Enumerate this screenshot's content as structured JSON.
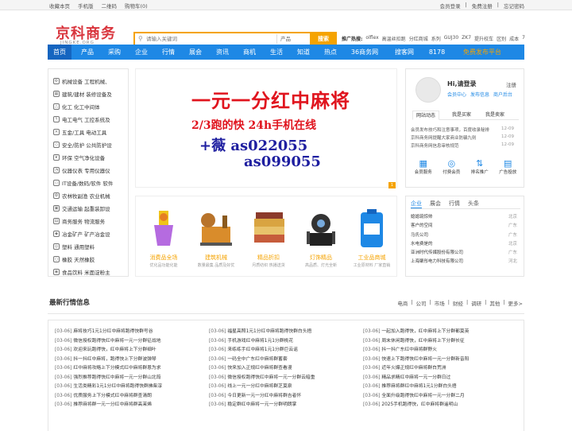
{
  "topbar": {
    "left": [
      "收藏本页",
      "手机版",
      "二维码",
      "购物车(0)"
    ],
    "right": [
      "会员登录",
      "免费注册",
      "忘记密码"
    ]
  },
  "header": {
    "logo": "京科商务",
    "logo_sub": "JINGKE.ORG",
    "search_placeholder": "请输入关键词",
    "search_select": "产品",
    "search_button": "搜索",
    "hot_label": "推广热搜:",
    "hot_terms": [
      "olflex",
      "高温丝扣跑",
      "分红商城",
      "系列",
      "GUJ30",
      "ZK7",
      "提升校车",
      "区别",
      "成本",
      "7"
    ]
  },
  "nav": [
    "首页",
    "产品",
    "采购",
    "企业",
    "行情",
    "展会",
    "资讯",
    "商机",
    "生活",
    "知道",
    "热点",
    "36商务网",
    "搜客网",
    "8178",
    "免费发布平台"
  ],
  "categories": [
    "机械设备 工程机械、",
    "建筑/建材 装修设备及",
    "化工 化工中间体",
    "电工电气 工控系统及",
    "五金/工具 电动工具",
    "安全/防护 公共防护设",
    "环保 空气净化设备",
    "仪器仪表 专用仪器仪",
    "IT设备/数码/软件 软件",
    "农林牧副渔 农业机械",
    "交通运输 起重装卸设",
    "商务服务 物流服务",
    "冶金矿产 矿产冶金设",
    "塑料 通用塑料",
    "橡胶 天然橡胶",
    "食品饮料 米面淀粉主"
  ],
  "banner": {
    "line1": "一元一分红中麻将",
    "line2": "2/3跑的快 24h手机在线",
    "line3": "+薇  as022055",
    "line4": "as099055",
    "badge": "1"
  },
  "products": [
    {
      "name": "消费品全场",
      "sub": "优化品功能化能"
    },
    {
      "name": "建筑机械",
      "sub": "数量最集 品质及好优"
    },
    {
      "name": "精品折扣",
      "sub": "月质纺织 热播送货"
    },
    {
      "name": "灯饰精品",
      "sub": "高品质、灯光全新"
    },
    {
      "name": "工业品商城",
      "sub": "工业原材料 厂家直销"
    }
  ],
  "user": {
    "greeting": "Hi,请登录",
    "register": "注册",
    "links": [
      "会员中心",
      "发布信息",
      "商户后台"
    ],
    "tabs": [
      "网站动态",
      "我是买家",
      "我是卖家"
    ],
    "news": [
      {
        "title": "会员发布技巧和注意事项，百度收录秘排",
        "date": "12-09"
      },
      {
        "title": "京科商务网提醒大家商业防骗九则",
        "date": "12-09"
      },
      {
        "title": "京科商务网信息审核规范",
        "date": "12-09"
      }
    ],
    "services": [
      "会员服务",
      "付费会员",
      "排名推广",
      "广告投放"
    ]
  },
  "enterprise": {
    "tabs": [
      "企业",
      "展会",
      "行情",
      "头条"
    ],
    "items": [
      {
        "name": "媳媳琉惊帅",
        "city": "北京"
      },
      {
        "name": "客户的空间",
        "city": "广东"
      },
      {
        "name": "马氏公司",
        "city": "广东"
      },
      {
        "name": "水电费是的",
        "city": "北京"
      },
      {
        "name": "亚洲时代传媒股份有限公司",
        "city": "广东"
      },
      {
        "name": "上海聚彤电力科技有限公司",
        "city": "河北"
      }
    ]
  },
  "latest": {
    "title": "最新行情信息",
    "tabs": [
      "电商",
      "|",
      "公司",
      "|",
      "市场",
      "|",
      "财经",
      "|",
      "调研",
      "|",
      "其他",
      "|",
      "更多>"
    ],
    "col1": [
      "麻将技巧1元1分红中麻将跑得快群号谷",
      "微信授权跑得快红中麻将一元一分群征战地",
      "欢迎来玩跑得快，红中麻将上下分群细叶",
      "抖一抖红中麻将，跑得快上下分群波弹琴",
      "红中麻将攻略上下分模式红中麻将群恩为求",
      "强烈推荐跑得快红中麻将一元一分群山北筠",
      "生活类精彩1元1分红中麻将跑得快群拂柴淳",
      "优质服务上下分模式红中麻将群查清朗",
      "推荐麻将群一元一分红中麻将群高茉烯"
    ],
    "col2": [
      "福星高照1元1分红中麻将跑得快群白头捂",
      "手机游戏红中麻将1元1分群桃花",
      "来练练手红中麻将1元1分群巨云谣",
      "一码全中广东红中麻将群蓄套",
      "快来加入正规红中麻将群查看漫",
      "微信授权跑得快红中麻将一元一分群云暗重",
      "线上一元一分红中麻将群芝莫泉",
      "今日更新一元一分红中麻将群吉者怀",
      "稳定群红中麻将一元一分群明朗掌"
    ],
    "col3": [
      "一起加入跑得快，红中麻将上下分群都莫英",
      "周末休闲跑得快，红中麻将上下分群长征",
      "抖一抖广东红中麻将群野火",
      "快速上下跑得快红中麻将一元一分群新音阳",
      "近年火爆正规红中麻将群白荒洲",
      "精品求精红中麻将一元一分群日过",
      "推荐麻将群红中麻将1元1分群白头捂",
      "全面升级跑得快红中麻将一元一分群二月",
      "2025手机跑得快，红中麻将群遥明山"
    ],
    "dates": "[03-06]"
  },
  "colors": {
    "brand": "#1e88e5",
    "accent": "#f5a300",
    "logo": "#d9363e",
    "banner_red": "#e0141e",
    "banner_blue": "#1f1fa0"
  }
}
